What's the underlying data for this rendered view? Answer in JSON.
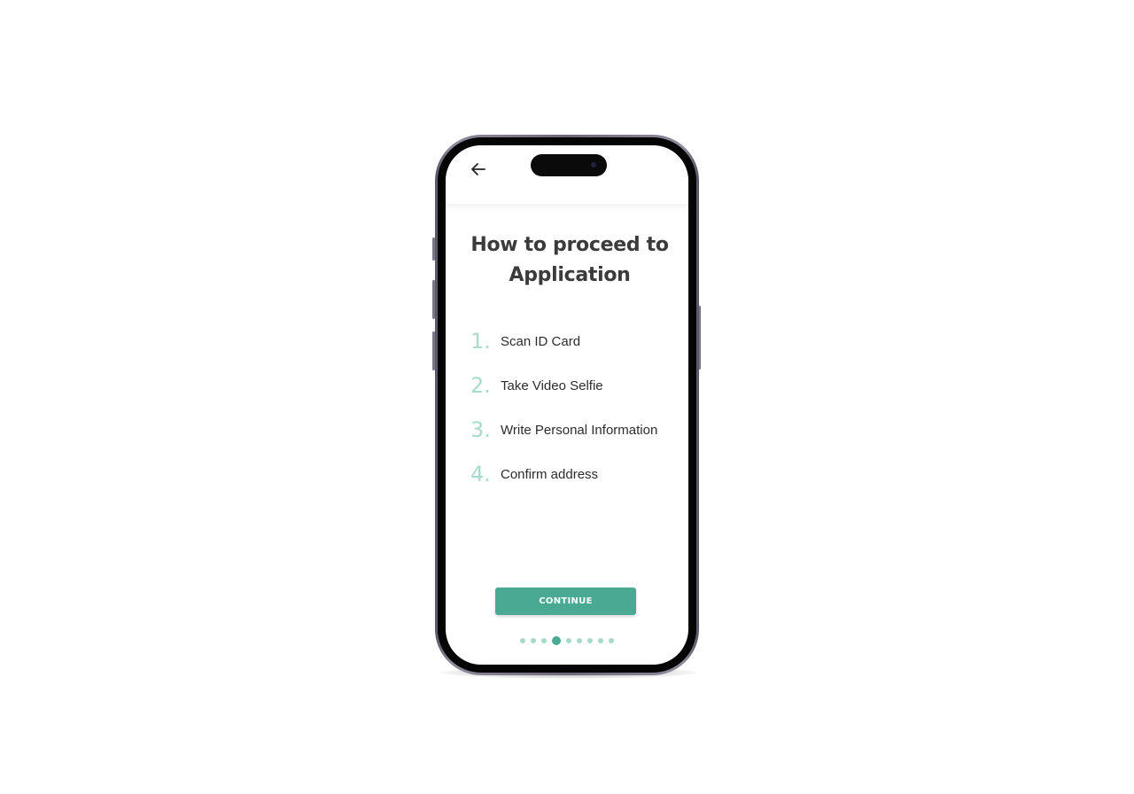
{
  "header": {
    "back_icon": "arrow-left-icon"
  },
  "main": {
    "title_line1": "How to proceed to",
    "title_line2": "Application",
    "steps": [
      {
        "number": "1.",
        "label": "Scan ID Card"
      },
      {
        "number": "2.",
        "label": "Take Video Selfie"
      },
      {
        "number": "3.",
        "label": "Write Personal Information"
      },
      {
        "number": "4.",
        "label": "Confirm address"
      }
    ],
    "continue_label": "CONTINUE"
  },
  "pagination": {
    "total": 9,
    "active_index": 3
  },
  "colors": {
    "accent": "#4aa993",
    "accent_light": "#a7dccd",
    "title": "#3b3b3b"
  }
}
